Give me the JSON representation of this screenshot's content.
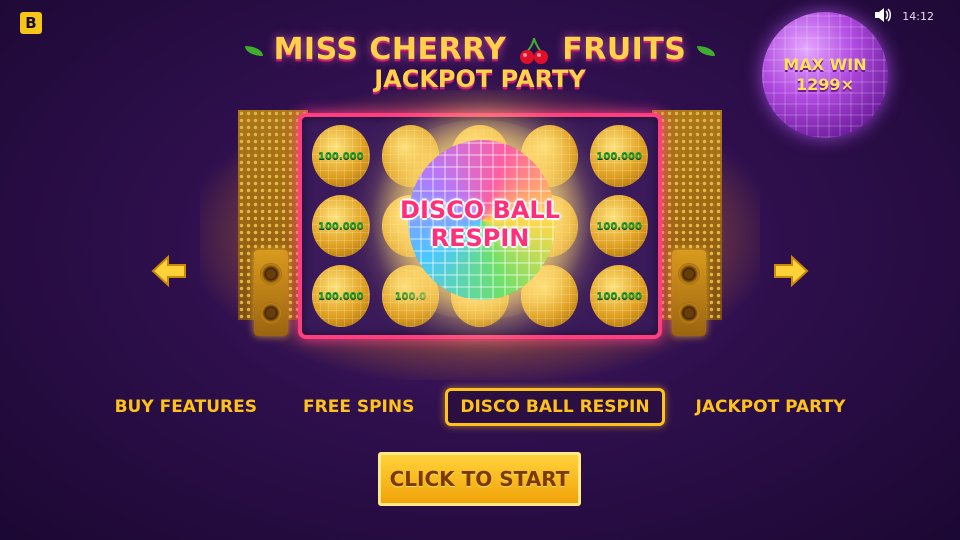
{
  "brand": {
    "logo_letter": "B"
  },
  "system": {
    "time": "14:12",
    "sound_icon": "speaker-icon"
  },
  "title": {
    "line1_part1": "MISS CHERRY",
    "line1_part2": "FRUITS",
    "line2": "JACKPOT PARTY"
  },
  "max_win": {
    "label": "MAX WIN",
    "value": "1299×"
  },
  "reels": {
    "cells": [
      "100.000",
      "",
      "",
      "",
      "100.000",
      "100.000",
      "",
      "",
      "",
      "100.000",
      "100.000",
      "100.0",
      "",
      "",
      "100.000"
    ]
  },
  "feature": {
    "caption_line1": "DISCO BALL",
    "caption_line2": "RESPIN"
  },
  "nav": {
    "prev_icon": "arrow-left-icon",
    "next_icon": "arrow-right-icon"
  },
  "tabs": [
    {
      "label": "BUY FEATURES",
      "active": false
    },
    {
      "label": "FREE SPINS",
      "active": false
    },
    {
      "label": "DISCO BALL RESPIN",
      "active": true
    },
    {
      "label": "JACKPOT PARTY",
      "active": false
    }
  ],
  "start": {
    "label": "CLICK TO START"
  },
  "colors": {
    "accent": "#ffc21a",
    "frame": "#ff3d7f",
    "caption": "#ff2f7a"
  }
}
